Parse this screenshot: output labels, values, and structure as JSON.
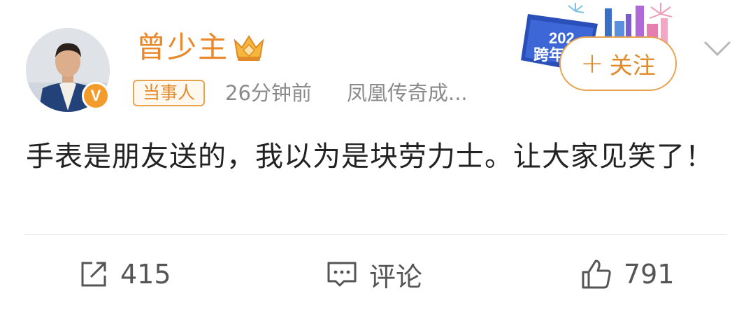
{
  "user": {
    "name": "曾少主",
    "verified_badge": "V",
    "crown_icon": "crown-icon",
    "tag": "当事人",
    "time": "26分钟前",
    "source": "凤凰传奇成..."
  },
  "follow": {
    "plus": "+",
    "label": "关注"
  },
  "banner": {
    "text1": "202",
    "text2": "跨年"
  },
  "post": {
    "content": "手表是朋友送的，我以为是块劳力士。让大家见笑了！"
  },
  "actions": {
    "repost_count": "415",
    "comment_label": "评论",
    "like_count": "791"
  },
  "colors": {
    "accent": "#e8882a",
    "meta": "#8a8a8a",
    "text": "#222222"
  }
}
